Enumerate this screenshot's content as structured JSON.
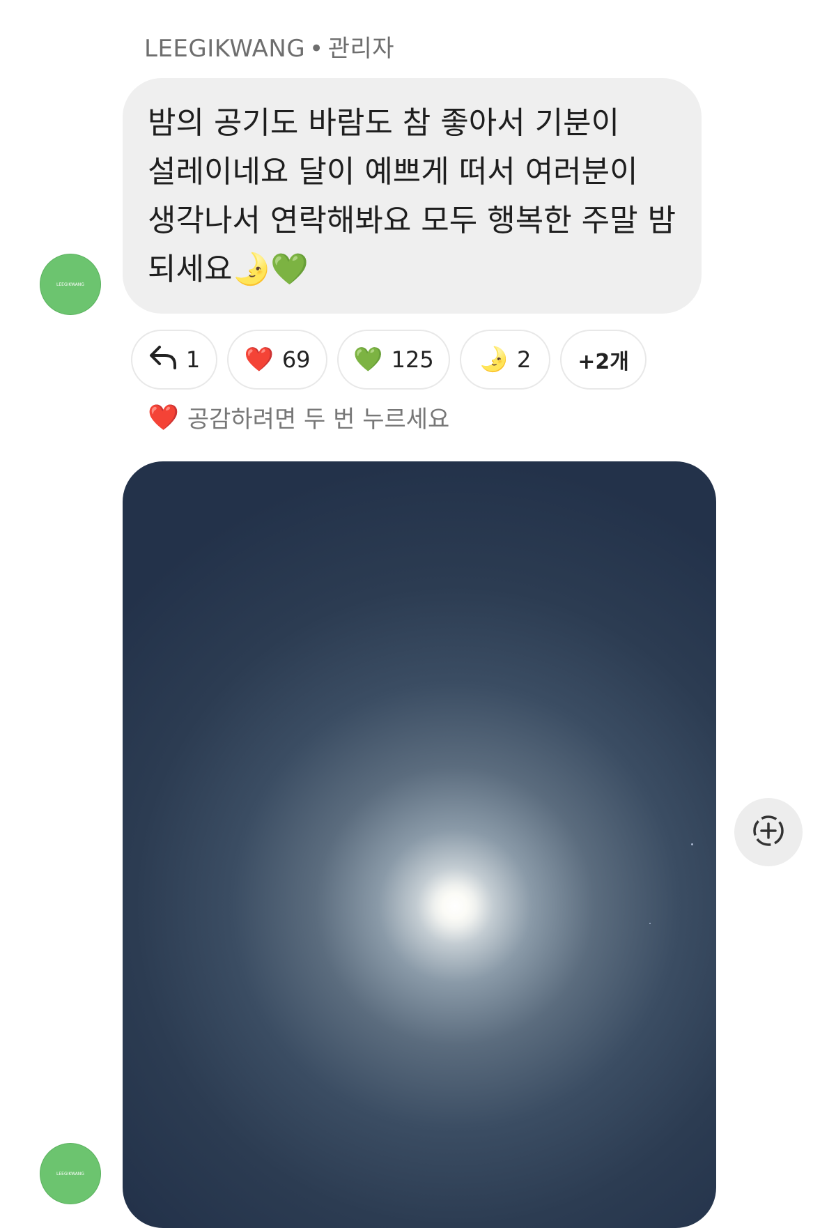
{
  "sender": {
    "name": "LEEGIKWANG",
    "separator": "•",
    "role": "관리자"
  },
  "avatar": {
    "label": "LEEGIKWANG"
  },
  "message": {
    "text": "밤의 공기도 바람도 참 좋아서 기분이 설레이네요 달이 예쁘게 떠서 여러분이 생각나서 연락해봐요 모두 행복한 주말 밤 되세요🌛💚"
  },
  "reactions": {
    "reply": {
      "icon": "reply-arrow-icon",
      "count": "1"
    },
    "red_heart": {
      "emoji": "❤️",
      "count": "69"
    },
    "green_heart": {
      "emoji": "💚",
      "count": "125"
    },
    "moon": {
      "emoji": "🌛",
      "count": "2"
    },
    "more": {
      "label": "+2개"
    }
  },
  "hint": {
    "emoji": "❤️",
    "text": "공감하려면 두 번 누르세요"
  },
  "photo": {
    "subject": "full moon in night sky"
  },
  "colors": {
    "bubble_bg": "#efefef",
    "avatar_green": "#6cc46f",
    "sky_dark": "#23324a"
  }
}
